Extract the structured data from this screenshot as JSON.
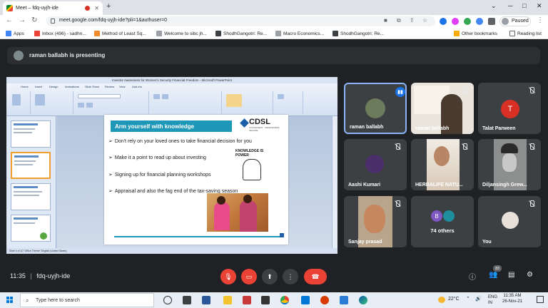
{
  "browser": {
    "tab_title": "Meet – fdq-uyjh-ide",
    "url": "meet.google.com/fdq-uyjh-ide?pli=1&authuser=0",
    "profile_status": "Paused",
    "bookmarks": [
      "Apps",
      "Inbox (496) - sadhn...",
      "Method of Least Sq...",
      "Welcome to sibc jh...",
      "ShodhGangotri: Re...",
      "Macro Economics...",
      "ShodhGangotri: Re..."
    ],
    "other_bookmarks": "Other bookmarks",
    "reading_list": "Reading list"
  },
  "meet": {
    "presenting_text": "raman ballabh is presenting",
    "meeting_code": "fdq-uyjh-ide",
    "time": "11:35",
    "people_count": "83",
    "accent_red": "#ea4335",
    "active_border": "#8ab4f8"
  },
  "presentation": {
    "window_title": "Investor Awareness for Women's Security Financial Freedom - Microsoft PowerPoint",
    "tabs": [
      "Home",
      "Insert",
      "Design",
      "Animations",
      "Slide Show",
      "Review",
      "View",
      "Add-Ins"
    ],
    "status_text": "Slide 4 of 10     \"Office Theme\"     English (United States)",
    "slide": {
      "title": "Arm yourself with knowledge",
      "logo": "CDSL",
      "logo_tagline": "CONVENIENT · DEPENDABLE · SECURE",
      "bullets": [
        "Don't rely on your loved ones to take financial decision for you",
        "Make it a point to read up about investing",
        "Signing up for financial planning workshops",
        "Appraisal and also the fag end of the tax-saving season"
      ],
      "graphic_text": "KNOWLEDGE IS POWER"
    }
  },
  "participants": [
    {
      "name": "raman ballabh",
      "active": true
    },
    {
      "name": "raman ballabh"
    },
    {
      "name": "Talat Parween",
      "initial": "T"
    },
    {
      "name": "Aashi Kumari"
    },
    {
      "name": "HERBALIFE NATU..."
    },
    {
      "name": "Diljansingh Grew..."
    },
    {
      "name": "Sanjay prasad"
    },
    {
      "name": "74 others",
      "initial": "B"
    },
    {
      "name": "You"
    }
  ],
  "taskbar": {
    "search_placeholder": "Type here to search",
    "temperature": "22°C",
    "lang": "ENG",
    "region": "IN",
    "time": "11:35 AM",
    "date": "26-Nov-21"
  }
}
